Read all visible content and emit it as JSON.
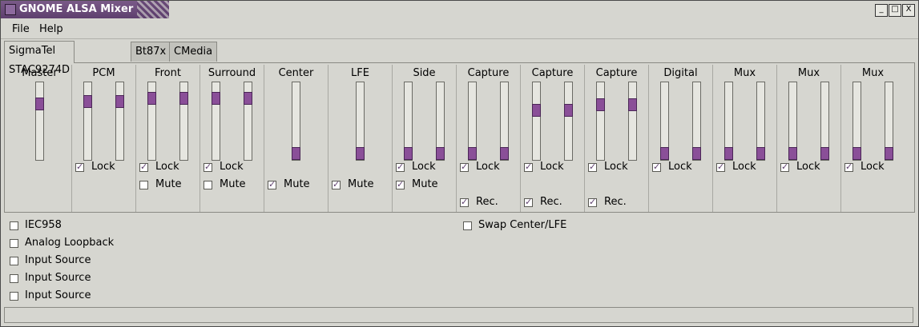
{
  "window": {
    "title": "GNOME ALSA Mixer",
    "minimize": "_",
    "maximize": "□",
    "close": "X"
  },
  "menu": [
    {
      "label": "File"
    },
    {
      "label": "Help"
    }
  ],
  "tabs": [
    {
      "label": "SigmaTel STAC9274D",
      "active": true
    },
    {
      "label": "Bt87x"
    },
    {
      "label": "CMedia PCI"
    }
  ],
  "channels": [
    {
      "name": "Master",
      "sliders": [
        0.76
      ],
      "lock": null,
      "mute": null,
      "rec": null
    },
    {
      "name": "PCM",
      "sliders": [
        0.8,
        0.8
      ],
      "lock": true,
      "mute": null,
      "rec": null
    },
    {
      "name": "Front",
      "sliders": [
        0.85,
        0.85
      ],
      "lock": true,
      "mute": false,
      "rec": null
    },
    {
      "name": "Surround",
      "sliders": [
        0.85,
        0.85
      ],
      "lock": true,
      "mute": false,
      "rec": null
    },
    {
      "name": "Center",
      "sliders": [
        0.0
      ],
      "lock": null,
      "mute": true,
      "rec": null
    },
    {
      "name": "LFE",
      "sliders": [
        0.0
      ],
      "lock": null,
      "mute": true,
      "rec": null
    },
    {
      "name": "Side",
      "sliders": [
        0.0,
        0.0
      ],
      "lock": true,
      "mute": true,
      "rec": null
    },
    {
      "name": "Capture",
      "sliders": [
        0.0,
        0.0
      ],
      "lock": true,
      "mute": null,
      "rec": true
    },
    {
      "name": "Capture",
      "sliders": [
        0.67,
        0.67
      ],
      "lock": true,
      "mute": null,
      "rec": true
    },
    {
      "name": "Capture",
      "sliders": [
        0.75,
        0.75
      ],
      "lock": true,
      "mute": null,
      "rec": true
    },
    {
      "name": "Digital",
      "sliders": [
        0.0,
        0.0
      ],
      "lock": true,
      "mute": null,
      "rec": null
    },
    {
      "name": "Mux",
      "sliders": [
        0.0,
        0.0
      ],
      "lock": true,
      "mute": null,
      "rec": null
    },
    {
      "name": "Mux",
      "sliders": [
        0.0,
        0.0
      ],
      "lock": true,
      "mute": null,
      "rec": null
    },
    {
      "name": "Mux",
      "sliders": [
        0.0,
        0.0
      ],
      "lock": true,
      "mute": null,
      "rec": null
    }
  ],
  "labels": {
    "lock": "Lock",
    "mute": "Mute",
    "rec": "Rec."
  },
  "switches_left": [
    {
      "label": "IEC958",
      "checked": false
    },
    {
      "label": "Analog Loopback",
      "checked": false
    },
    {
      "label": "Input Source",
      "checked": false
    },
    {
      "label": "Input Source",
      "checked": false
    },
    {
      "label": "Input Source",
      "checked": false
    }
  ],
  "switches_right": [
    {
      "label": "Swap Center/LFE",
      "checked": false
    }
  ],
  "status_text": ""
}
